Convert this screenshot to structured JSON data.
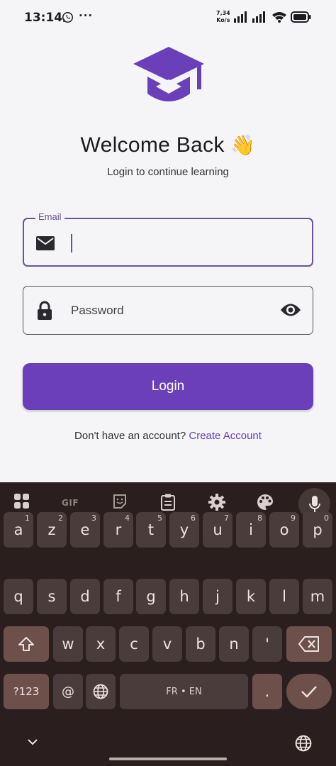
{
  "status_bar": {
    "time": "13:14",
    "dots": "···",
    "net_speed_value": "7,34",
    "net_speed_unit": "Ko/s"
  },
  "login": {
    "title": "Welcome Back",
    "title_emoji": "👋",
    "subtitle": "Login to continue learning",
    "email_label": "Email",
    "password_placeholder": "Password",
    "login_button": "Login",
    "no_account_text": "Don't have an account?",
    "create_account_link": "Create Account"
  },
  "keyboard": {
    "toolbar": {
      "gif": "GIF"
    },
    "row1": [
      {
        "k": "a",
        "h": "1"
      },
      {
        "k": "z",
        "h": "2"
      },
      {
        "k": "e",
        "h": "3"
      },
      {
        "k": "r",
        "h": "4"
      },
      {
        "k": "t",
        "h": "5"
      },
      {
        "k": "y",
        "h": "6"
      },
      {
        "k": "u",
        "h": "7"
      },
      {
        "k": "i",
        "h": "8"
      },
      {
        "k": "o",
        "h": "9"
      },
      {
        "k": "p",
        "h": "0"
      }
    ],
    "row2": [
      "q",
      "s",
      "d",
      "f",
      "g",
      "h",
      "j",
      "k",
      "l",
      "m"
    ],
    "row3": [
      "w",
      "x",
      "c",
      "v",
      "b",
      "n",
      "'"
    ],
    "symbols_key": "?123",
    "at_key": "@",
    "space_label": "FR • EN",
    "period_key": "."
  },
  "colors": {
    "accent": "#6b3fba",
    "focus_border": "#6a5494",
    "background": "#f5f4f6",
    "keyboard_bg": "#2a1f1e",
    "key_bg": "#4a3c3a",
    "function_key_bg": "#6e504b"
  }
}
